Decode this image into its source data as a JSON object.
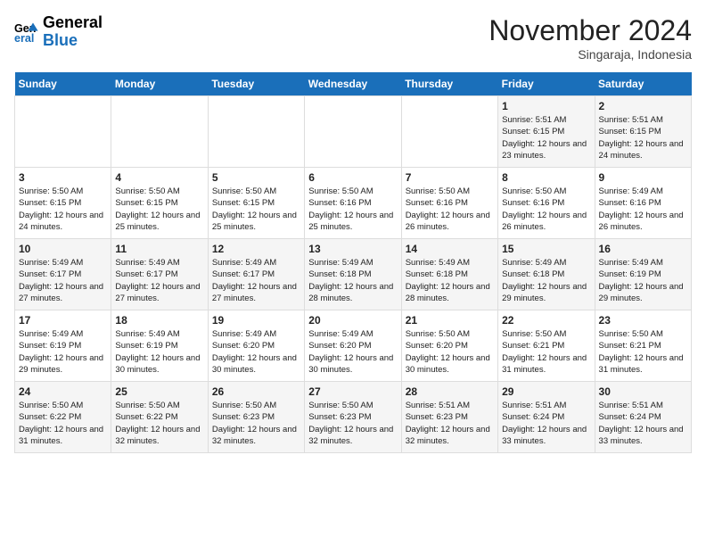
{
  "header": {
    "logo_line1": "General",
    "logo_line2": "Blue",
    "month": "November 2024",
    "location": "Singaraja, Indonesia"
  },
  "days_of_week": [
    "Sunday",
    "Monday",
    "Tuesday",
    "Wednesday",
    "Thursday",
    "Friday",
    "Saturday"
  ],
  "weeks": [
    [
      {
        "day": "",
        "info": ""
      },
      {
        "day": "",
        "info": ""
      },
      {
        "day": "",
        "info": ""
      },
      {
        "day": "",
        "info": ""
      },
      {
        "day": "",
        "info": ""
      },
      {
        "day": "1",
        "info": "Sunrise: 5:51 AM\nSunset: 6:15 PM\nDaylight: 12 hours and 23 minutes."
      },
      {
        "day": "2",
        "info": "Sunrise: 5:51 AM\nSunset: 6:15 PM\nDaylight: 12 hours and 24 minutes."
      }
    ],
    [
      {
        "day": "3",
        "info": "Sunrise: 5:50 AM\nSunset: 6:15 PM\nDaylight: 12 hours and 24 minutes."
      },
      {
        "day": "4",
        "info": "Sunrise: 5:50 AM\nSunset: 6:15 PM\nDaylight: 12 hours and 25 minutes."
      },
      {
        "day": "5",
        "info": "Sunrise: 5:50 AM\nSunset: 6:15 PM\nDaylight: 12 hours and 25 minutes."
      },
      {
        "day": "6",
        "info": "Sunrise: 5:50 AM\nSunset: 6:16 PM\nDaylight: 12 hours and 25 minutes."
      },
      {
        "day": "7",
        "info": "Sunrise: 5:50 AM\nSunset: 6:16 PM\nDaylight: 12 hours and 26 minutes."
      },
      {
        "day": "8",
        "info": "Sunrise: 5:50 AM\nSunset: 6:16 PM\nDaylight: 12 hours and 26 minutes."
      },
      {
        "day": "9",
        "info": "Sunrise: 5:49 AM\nSunset: 6:16 PM\nDaylight: 12 hours and 26 minutes."
      }
    ],
    [
      {
        "day": "10",
        "info": "Sunrise: 5:49 AM\nSunset: 6:17 PM\nDaylight: 12 hours and 27 minutes."
      },
      {
        "day": "11",
        "info": "Sunrise: 5:49 AM\nSunset: 6:17 PM\nDaylight: 12 hours and 27 minutes."
      },
      {
        "day": "12",
        "info": "Sunrise: 5:49 AM\nSunset: 6:17 PM\nDaylight: 12 hours and 27 minutes."
      },
      {
        "day": "13",
        "info": "Sunrise: 5:49 AM\nSunset: 6:18 PM\nDaylight: 12 hours and 28 minutes."
      },
      {
        "day": "14",
        "info": "Sunrise: 5:49 AM\nSunset: 6:18 PM\nDaylight: 12 hours and 28 minutes."
      },
      {
        "day": "15",
        "info": "Sunrise: 5:49 AM\nSunset: 6:18 PM\nDaylight: 12 hours and 29 minutes."
      },
      {
        "day": "16",
        "info": "Sunrise: 5:49 AM\nSunset: 6:19 PM\nDaylight: 12 hours and 29 minutes."
      }
    ],
    [
      {
        "day": "17",
        "info": "Sunrise: 5:49 AM\nSunset: 6:19 PM\nDaylight: 12 hours and 29 minutes."
      },
      {
        "day": "18",
        "info": "Sunrise: 5:49 AM\nSunset: 6:19 PM\nDaylight: 12 hours and 30 minutes."
      },
      {
        "day": "19",
        "info": "Sunrise: 5:49 AM\nSunset: 6:20 PM\nDaylight: 12 hours and 30 minutes."
      },
      {
        "day": "20",
        "info": "Sunrise: 5:49 AM\nSunset: 6:20 PM\nDaylight: 12 hours and 30 minutes."
      },
      {
        "day": "21",
        "info": "Sunrise: 5:50 AM\nSunset: 6:20 PM\nDaylight: 12 hours and 30 minutes."
      },
      {
        "day": "22",
        "info": "Sunrise: 5:50 AM\nSunset: 6:21 PM\nDaylight: 12 hours and 31 minutes."
      },
      {
        "day": "23",
        "info": "Sunrise: 5:50 AM\nSunset: 6:21 PM\nDaylight: 12 hours and 31 minutes."
      }
    ],
    [
      {
        "day": "24",
        "info": "Sunrise: 5:50 AM\nSunset: 6:22 PM\nDaylight: 12 hours and 31 minutes."
      },
      {
        "day": "25",
        "info": "Sunrise: 5:50 AM\nSunset: 6:22 PM\nDaylight: 12 hours and 32 minutes."
      },
      {
        "day": "26",
        "info": "Sunrise: 5:50 AM\nSunset: 6:23 PM\nDaylight: 12 hours and 32 minutes."
      },
      {
        "day": "27",
        "info": "Sunrise: 5:50 AM\nSunset: 6:23 PM\nDaylight: 12 hours and 32 minutes."
      },
      {
        "day": "28",
        "info": "Sunrise: 5:51 AM\nSunset: 6:23 PM\nDaylight: 12 hours and 32 minutes."
      },
      {
        "day": "29",
        "info": "Sunrise: 5:51 AM\nSunset: 6:24 PM\nDaylight: 12 hours and 33 minutes."
      },
      {
        "day": "30",
        "info": "Sunrise: 5:51 AM\nSunset: 6:24 PM\nDaylight: 12 hours and 33 minutes."
      }
    ]
  ]
}
